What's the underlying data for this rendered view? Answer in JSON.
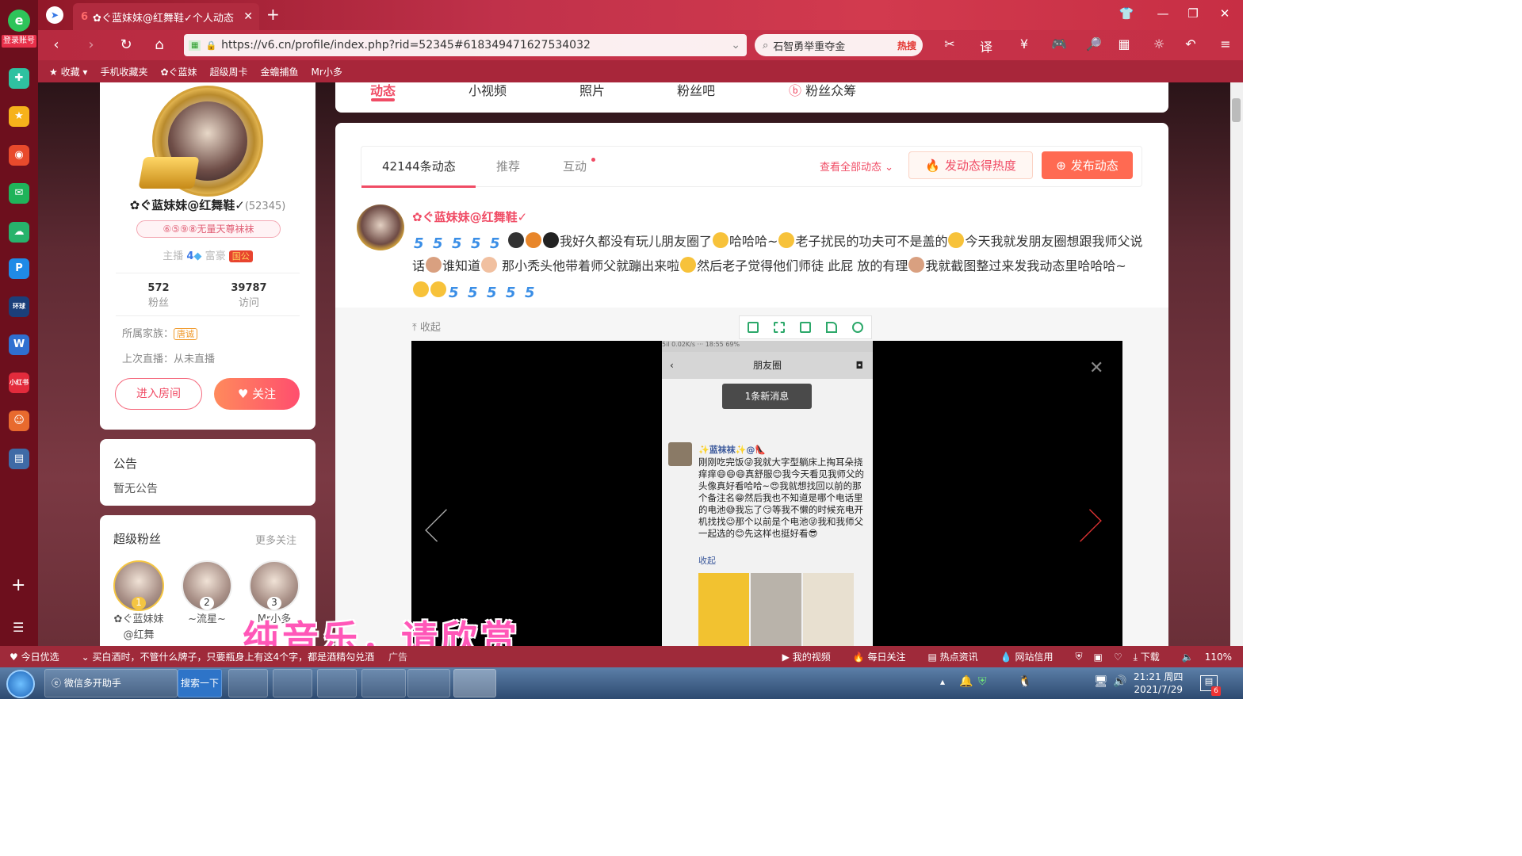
{
  "browser": {
    "login_label": "登录账号",
    "tab_title": "✿ぐ蓝妹妹@红舞鞋✓个人动态",
    "url": "https://v6.cn/profile/index.php?rid=52345#618349471627534032",
    "search_value": "石智勇举重夺金",
    "search_hot": "热搜",
    "bookmarks": [
      "收藏",
      "手机收藏夹",
      "✿ぐ蓝妹",
      "超级周卡",
      "金蟾捕鱼",
      "Mr小多"
    ]
  },
  "profile": {
    "name": "✿ぐ蓝妹妹@红舞鞋✓",
    "rid": "(52345)",
    "noble_badge": "⑥⑤⑨⑧无量天尊袜袜",
    "host_label": "主播",
    "host_level": "4",
    "rich_label": "富豪",
    "rich_badge": "国公",
    "fans_count": "572",
    "fans_label": "粉丝",
    "visits_count": "39787",
    "visits_label": "访问",
    "family_label": "所属家族：",
    "family_badge": "唐诚",
    "last_live": "上次直播：从未直播",
    "enter_room": "进入房间",
    "follow": "关注"
  },
  "notice": {
    "title": "公告",
    "text": "暂无公告"
  },
  "fans": {
    "title": "超级粉丝",
    "more": "更多关注",
    "items": [
      {
        "rank": "1",
        "name": "✿ぐ蓝妹妹@红舞"
      },
      {
        "rank": "2",
        "name": "~流星~"
      },
      {
        "rank": "3",
        "name": "Mr小多"
      }
    ]
  },
  "nav_tabs": [
    "动态",
    "小视频",
    "照片",
    "粉丝吧",
    "粉丝众筹"
  ],
  "feed": {
    "tabs": [
      "42144条动态",
      "推荐",
      "互动"
    ],
    "view_all": "查看全部动态",
    "hot_button": "发动态得热度",
    "publish_button": "发布动态",
    "post": {
      "author": "✿ぐ蓝妹妹@红舞鞋✓",
      "text_1": "我好久都没有玩儿朋友圈了",
      "text_2": "哈哈哈~",
      "text_3": "老子扰民的功夫可不是盖的",
      "text_4": "今天我就发朋友圈想跟我师父说话",
      "text_5": "谁知道",
      "text_6": "那小秃头他带着师父就蹦出来啦",
      "text_7": "然后老子觉得他们师徒 此屁 放的有理",
      "text_8": "我就截图整过来发我动态里哈哈哈~"
    },
    "collapse": "收起"
  },
  "phone_screenshot": {
    "status": "5il 0.02K/s ···          18:55          69%",
    "title": "朋友圈",
    "new_message": "1条新消息",
    "moment_name": "✨蓝袜袜✨@👠",
    "moment_text": "刚刚吃完饭😜我就大字型躺床上掏耳朵挠痒痒😄😄😄真舒服😌我今天看见我师父的头像真好看哈哈~😍我就想找回以前的那个备注名😁然后我也不知道是哪个电话里的电池😅我忘了😏等我不懒的时候充电开机找找😉那个以前是个电池😜我和我师父一起选的😊先这样也挺好看😎",
    "moment_collapse": "收起"
  },
  "subtitle": "纯音乐，请欣赏",
  "statusbar": {
    "items": [
      "今日优选",
      "买白酒时，不管什么牌子，只要瓶身上有这4个字，都是酒精勾兑酒",
      "广告",
      "我的视频",
      "每日关注",
      "热点资讯",
      "网站信用",
      "下载",
      "110%"
    ]
  },
  "taskbar": {
    "app_label": "微信多开助手",
    "search_label": "搜索一下",
    "time": "21:21 周四",
    "date": "2021/7/29",
    "badge": "6"
  },
  "colors": {
    "accent": "#f04c65",
    "publish": "#ff6a52",
    "browser_red": "#c7334a"
  }
}
